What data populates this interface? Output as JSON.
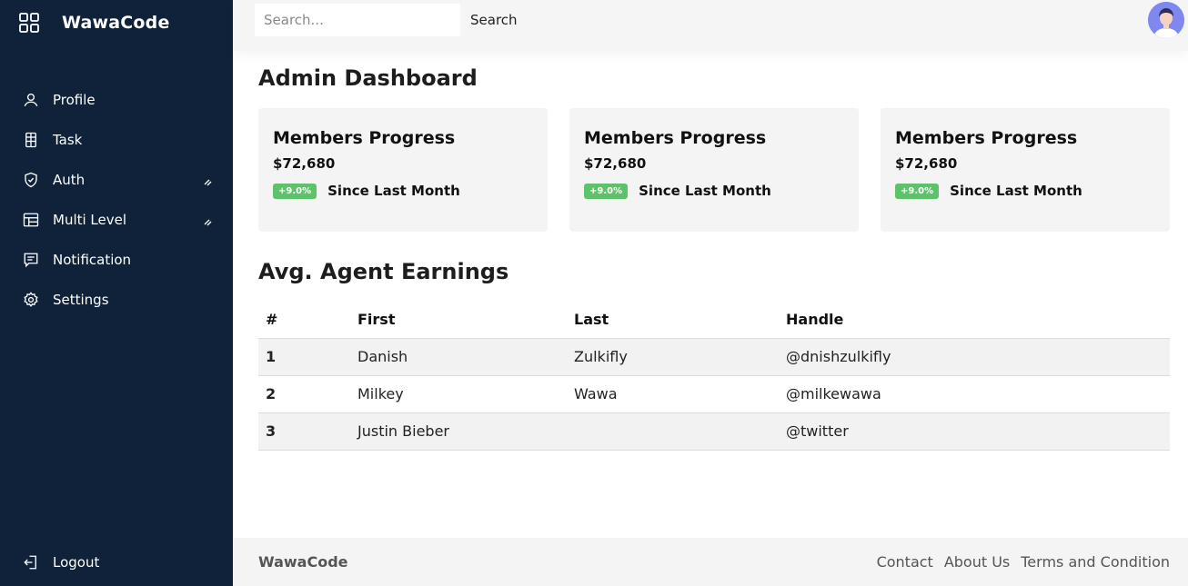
{
  "sidebar": {
    "brand": "WawaCode",
    "items": [
      {
        "label": "Profile"
      },
      {
        "label": "Task"
      },
      {
        "label": "Auth"
      },
      {
        "label": "Multi Level"
      },
      {
        "label": "Notification"
      },
      {
        "label": "Settings"
      }
    ],
    "logout": "Logout"
  },
  "topbar": {
    "search_placeholder": "Search...",
    "search_label": "Search"
  },
  "main": {
    "title": "Admin Dashboard",
    "cards": [
      {
        "title": "Members Progress",
        "value": "$72,680",
        "badge": "+9.0%",
        "since": "Since Last Month"
      },
      {
        "title": "Members Progress",
        "value": "$72,680",
        "badge": "+9.0%",
        "since": "Since Last Month"
      },
      {
        "title": "Members Progress",
        "value": "$72,680",
        "badge": "+9.0%",
        "since": "Since Last Month"
      }
    ],
    "table_title": "Avg. Agent Earnings",
    "table": {
      "headers": [
        "#",
        "First",
        "Last",
        "Handle"
      ],
      "rows": [
        [
          "1",
          "Danish",
          "Zulkifly",
          "@dnishzulkifly"
        ],
        [
          "2",
          "Milkey",
          "Wawa",
          "@milkewawa"
        ],
        [
          "3",
          "Justin Bieber",
          "",
          "@twitter"
        ]
      ]
    }
  },
  "footer": {
    "brand": "WawaCode",
    "links": [
      "Contact",
      "About Us",
      "Terms and Condition"
    ]
  },
  "colors": {
    "sidebar_bg": "#0f2239",
    "badge_green": "#5ec26a",
    "avatar_bg": "#7f88ee"
  }
}
